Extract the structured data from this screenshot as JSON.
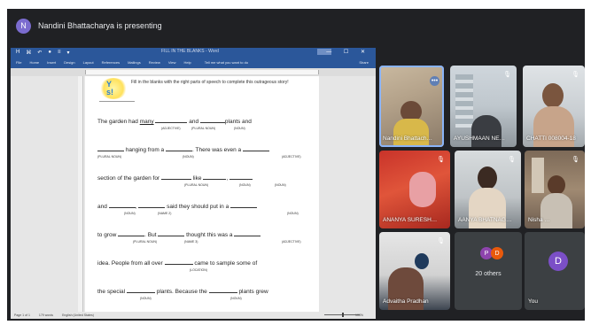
{
  "presenter_bar": {
    "avatar_initial": "N",
    "text": "Nandini Bhattacharya is presenting"
  },
  "word": {
    "quick_access": [
      "H",
      "⌘",
      "↶",
      "●",
      "≡",
      "▾"
    ],
    "title": "FILL IN THE BLANKS - Word",
    "window_controls": "— ☐ ✕",
    "ribbon_tabs": [
      "File",
      "Home",
      "Insert",
      "Design",
      "Layout",
      "References",
      "Mailings",
      "Review",
      "View",
      "Help"
    ],
    "tell_me": "Tell me what you want to do",
    "share": "Share",
    "status_page": "Page 1 of 1",
    "status_words": "179 words",
    "status_lang": "English (United States)",
    "zoom": "100%"
  },
  "document": {
    "sticker_text": "Y\ns!",
    "instruction": "Fill in the blanks with the right parts of speech to complete this outrageous story!",
    "lines": [
      {
        "t1": "The garden had ",
        "t1u": "many",
        "t2": "and",
        "t3": "plants and"
      },
      {
        "t1": "hanging from a",
        "t2": ". There was even a"
      },
      {
        "t1": "section of the garden for",
        "t2": "like",
        "t3": ","
      },
      {
        "t1": "and",
        "t2": ",",
        "t3": "said they should put in a"
      },
      {
        "t1": "to grow",
        "t2": ". But",
        "t3": "thought this was a"
      },
      {
        "t1": "idea.  People from all over",
        "t2": "came  to sample some of"
      },
      {
        "t1": "the special",
        "t2": "plants. Because the",
        "t3": "plants grew"
      }
    ],
    "labels": {
      "adjective": "(ADJECTIVE)",
      "plural_noun": "(PLURAL NOUN)",
      "noun": "(NOUN)",
      "name_2": "(NAME 2)",
      "name_3": "(NAME 3)",
      "location": "(LOCATION)"
    }
  },
  "tiles": [
    {
      "name": "Nandini Bhattach…",
      "more": "•••"
    },
    {
      "name": "AYUSHMAAN NE…"
    },
    {
      "name": "CHATTI 008004-18"
    },
    {
      "name": "ANANYA SURESH…"
    },
    {
      "name": "AANYA BHATNAG…"
    },
    {
      "name": "Nisha …"
    },
    {
      "name": "Advaitha Pradhan"
    },
    {
      "name": "20 others",
      "avatars": [
        "P",
        "D"
      ]
    },
    {
      "name": "You",
      "avatar": "D"
    }
  ],
  "mic_muted_glyph": "🎙"
}
